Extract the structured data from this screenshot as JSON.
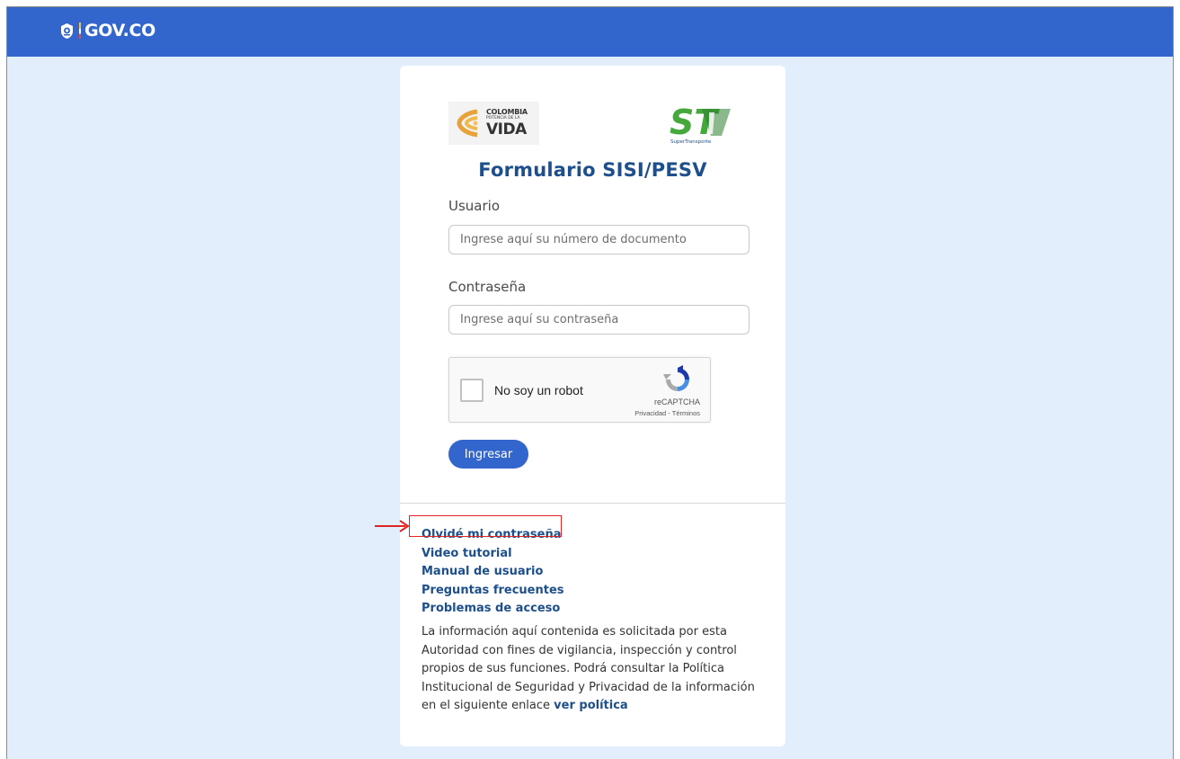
{
  "header": {
    "brand": "GOV.CO"
  },
  "logos": {
    "colombia": {
      "line1": "COLOMBIA",
      "line2": "POTENCIA DE LA",
      "line3": "VIDA"
    },
    "supertransporte": {
      "mark": "ST",
      "caption": "SuperTransporte"
    }
  },
  "form": {
    "title": "Formulario SISI/PESV",
    "user_label": "Usuario",
    "user_placeholder": "Ingrese aquí su número de documento",
    "password_label": "Contraseña",
    "password_placeholder": "Ingrese aquí su contraseña",
    "captcha": {
      "label": "No soy un robot",
      "brand": "reCAPTCHA",
      "links": "Privacidad - Términos"
    },
    "submit_label": "Ingresar"
  },
  "links": [
    "Olvidé mi contraseña",
    "Video tutorial",
    "Manual de usuario",
    "Preguntas frecuentes",
    "Problemas de acceso"
  ],
  "policy": {
    "text": "La información aquí contenida es solicitada por esta Autoridad con fines de vigilancia, inspección y control propios de sus funciones. Podrá consultar la Política Institucional de Seguridad y Privacidad de la información en el siguiente enlace",
    "link": "ver política"
  },
  "colors": {
    "primary": "#3366cc",
    "background": "#e3eefd",
    "title": "#1d4f8c",
    "highlight": "#e02424"
  }
}
